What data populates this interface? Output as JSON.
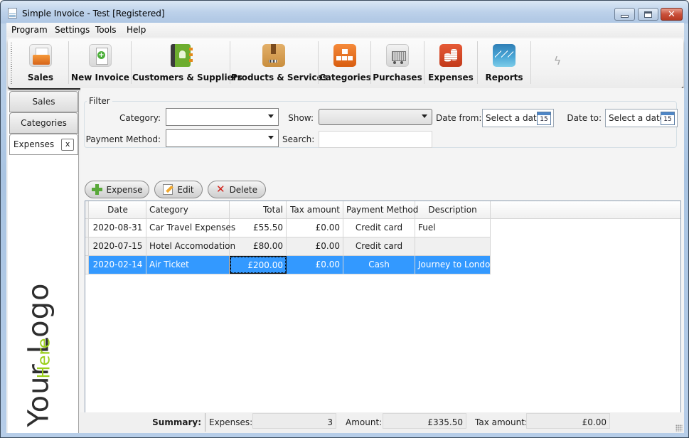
{
  "window": {
    "title": "Simple Invoice - Test   [Registered]",
    "controls": {
      "minimize": "minimize",
      "maximize": "maximize",
      "close": "✕"
    }
  },
  "menu": [
    "Program",
    "Settings",
    "Tools",
    "Help"
  ],
  "ribbon": [
    {
      "label": "Sales",
      "icon": "sales-folder-icon"
    },
    {
      "label": "New Invoice",
      "icon": "new-invoice-icon"
    },
    {
      "label": "Customers & Suppliers",
      "icon": "address-book-icon"
    },
    {
      "label": "Products & Services",
      "icon": "package-box-icon"
    },
    {
      "label": "Categories",
      "icon": "hierarchy-icon"
    },
    {
      "label": "Purchases",
      "icon": "shopping-cart-icon"
    },
    {
      "label": "Expenses",
      "icon": "coins-icon"
    },
    {
      "label": "Reports",
      "icon": "chart-icon"
    }
  ],
  "ribbon_extra_icon": "ϟ",
  "side_tabs": [
    {
      "label": "Sales",
      "active": false
    },
    {
      "label": "Categories",
      "active": false
    },
    {
      "label": "Expenses",
      "active": true,
      "close_label": "x"
    }
  ],
  "logo": {
    "main": "Your Logo",
    "sub": "Here"
  },
  "filter": {
    "title": "Filter",
    "category_label": "Category:",
    "category_value": "",
    "payment_label": "Payment Method:",
    "payment_value": "",
    "show_label": "Show:",
    "show_value": "",
    "search_label": "Search:",
    "search_value": "",
    "date_from_label": "Date from:",
    "date_from_placeholder": "Select a date",
    "date_to_label": "Date to:",
    "date_to_placeholder": "Select a date",
    "calendar_day": "15"
  },
  "actions": {
    "add": "Expense",
    "edit": "Edit",
    "delete": "Delete"
  },
  "grid": {
    "columns": [
      "Date",
      "Category",
      "Total",
      "Tax amount",
      "Payment Method",
      "Description"
    ],
    "rows": [
      {
        "date": "2020-08-31",
        "category": "Car Travel Expenses",
        "total": "£55.50",
        "tax": "£0.00",
        "payment": "Credit card",
        "description": "Fuel"
      },
      {
        "date": "2020-07-15",
        "category": "Hotel Accomodation",
        "total": "£80.00",
        "tax": "£0.00",
        "payment": "Credit card",
        "description": ""
      },
      {
        "date": "2020-02-14",
        "category": "Air Ticket",
        "total": "£200.00",
        "tax": "£0.00",
        "payment": "Cash",
        "description": "Journey to London"
      }
    ],
    "selected_row": 2
  },
  "summary": {
    "label": "Summary:",
    "expenses_label": "Expenses:",
    "expenses_value": "3",
    "amount_label": "Amount:",
    "amount_value": "£335.50",
    "tax_label": "Tax amount:",
    "tax_value": "£0.00"
  }
}
